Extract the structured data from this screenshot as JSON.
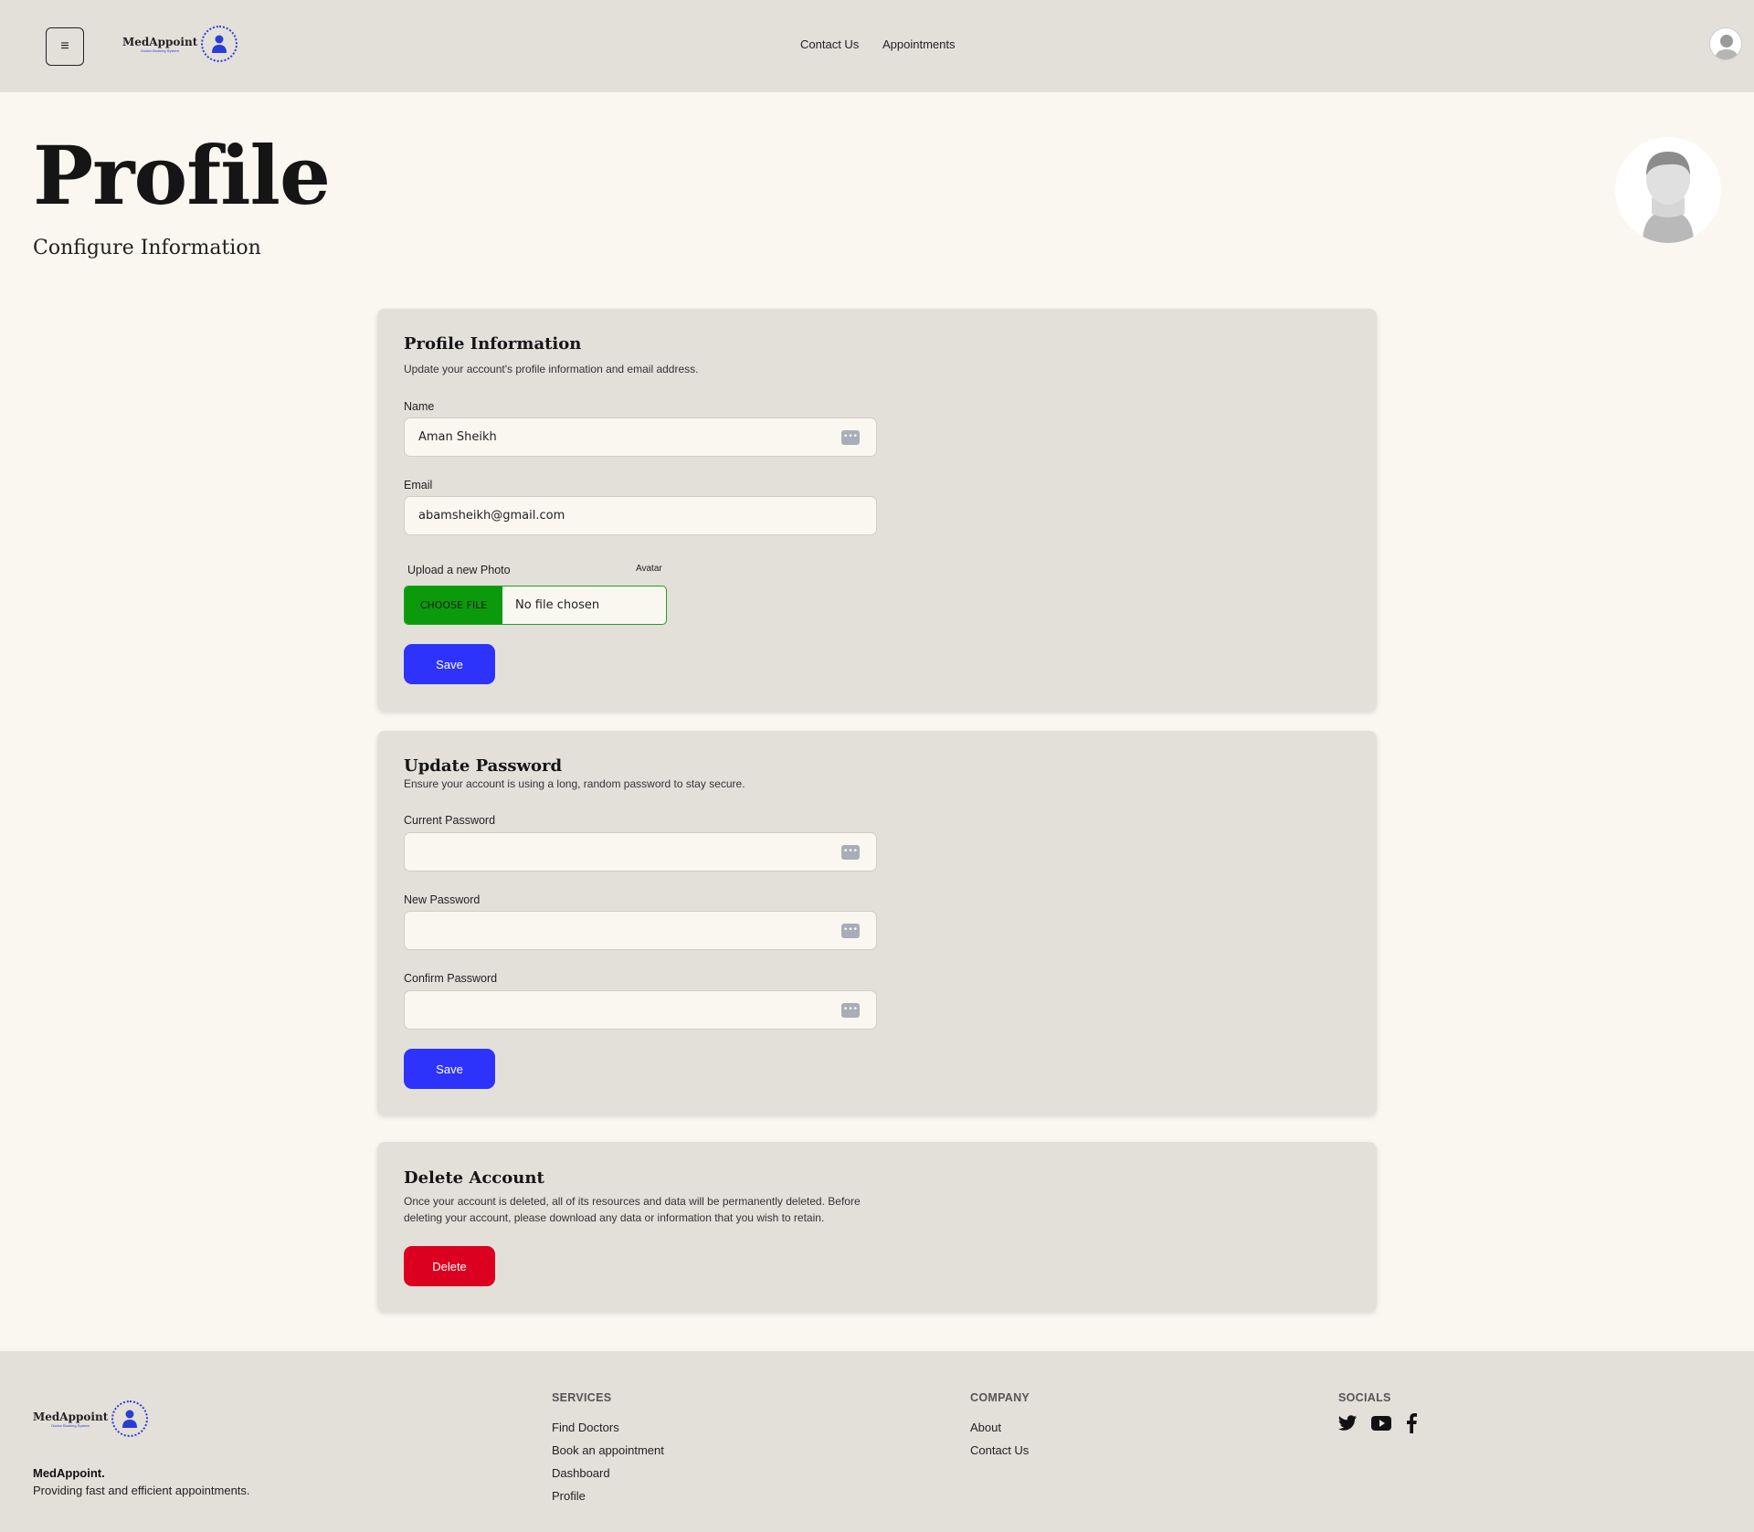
{
  "header": {
    "menu_icon": "≡",
    "logo_text": "MedAppoint",
    "logo_sub": "Doctor Booking System",
    "nav": [
      "Contact Us",
      "Appointments"
    ]
  },
  "page": {
    "title": "Profile",
    "subtitle": "Configure Information"
  },
  "profile_info": {
    "title": "Profile Information",
    "description": "Update your account's profile information and email address.",
    "name_label": "Name",
    "name_value": "Aman Sheikh",
    "email_label": "Email",
    "email_value": "abamsheikh@gmail.com",
    "upload_label": "Upload a new Photo",
    "avatar_label": "Avatar",
    "choose_file": "CHOOSE FILE",
    "no_file": "No file chosen",
    "save_label": "Save"
  },
  "update_password": {
    "title": "Update Password",
    "description": "Ensure your account is using a long, random password to stay secure.",
    "current_label": "Current Password",
    "new_label": "New Password",
    "confirm_label": "Confirm Password",
    "save_label": "Save"
  },
  "delete_account": {
    "title": "Delete Account",
    "description_1": "Once your account is deleted, all of its resources and data will be permanently deleted. Before",
    "description_2": "deleting your account, please download any data or information that you wish to retain.",
    "delete_label": "Delete"
  },
  "footer": {
    "logo_text": "MedAppoint",
    "brand": "MedAppoint.",
    "tagline": "Providing fast and efficient appointments.",
    "services_title": "SERVICES",
    "services": [
      "Find Doctors",
      "Book an appointment",
      "Dashboard",
      "Profile"
    ],
    "company_title": "COMPANY",
    "company": [
      "About",
      "Contact Us"
    ],
    "socials_title": "SOCIALS",
    "socials": [
      "twitter-icon",
      "youtube-icon",
      "facebook-icon"
    ]
  },
  "colors": {
    "primary_button": "#2e33fb",
    "danger_button": "#dc0020",
    "file_button": "#0b9a0b",
    "background": "#f9f7f0",
    "panel": "#e3e0da"
  }
}
